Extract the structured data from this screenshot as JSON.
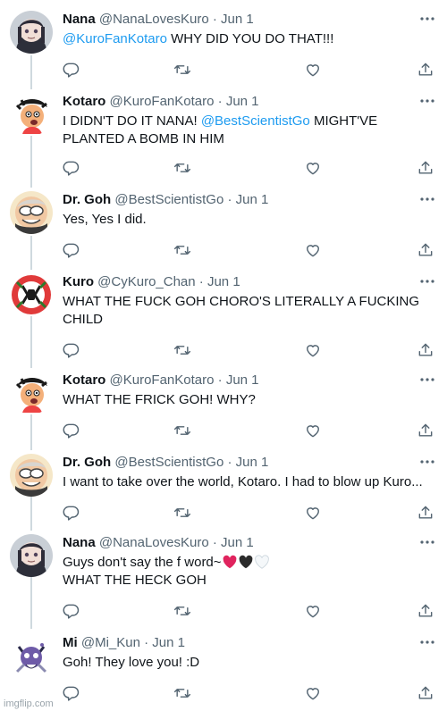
{
  "tweets": [
    {
      "name": "Nana",
      "handle": "@NanaLovesKuro",
      "time": "Jun 1",
      "mention": "@KuroFanKotaro",
      "text": " WHY DID YOU DO THAT!!!",
      "avatar": "nana-avatar"
    },
    {
      "name": "Kotaro",
      "handle": "@KuroFanKotaro",
      "time": "Jun 1",
      "text_a": "I DIDN'T DO IT NANA! ",
      "mention": "@BestScientistGo",
      "text_b": " MIGHT'VE PLANTED A BOMB IN HIM",
      "avatar": "kotaro-avatar"
    },
    {
      "name": "Dr. Goh",
      "handle": "@BestScientistGo",
      "time": "Jun 1",
      "text": "Yes, Yes I did.",
      "avatar": "goh-avatar"
    },
    {
      "name": "Kuro",
      "handle": "@CyKuro_Chan",
      "time": "Jun 1",
      "text": "WHAT THE FUCK GOH CHORO'S LITERALLY A FUCKING CHILD",
      "avatar": "kuro-avatar"
    },
    {
      "name": "Kotaro",
      "handle": "@KuroFanKotaro",
      "time": "Jun 1",
      "text": "WHAT THE FRICK GOH! WHY?",
      "avatar": "kotaro-avatar"
    },
    {
      "name": "Dr. Goh",
      "handle": "@BestScientistGo",
      "time": "Jun 1",
      "text": "I want to take over the world, Kotaro. I had to blow up Kuro...",
      "avatar": "goh-avatar"
    },
    {
      "name": "Nana",
      "handle": "@NanaLovesKuro",
      "time": "Jun 1",
      "text_a": "Guys don't say the f word~",
      "text_b": "WHAT THE HECK GOH",
      "hearts": [
        "red-heart",
        "black-heart",
        "white-heart"
      ],
      "avatar": "nana-avatar"
    },
    {
      "name": "Mi",
      "handle": "@Mi_Kun",
      "time": "Jun 1",
      "text": "Goh! They love you! :D",
      "avatar": "mi-avatar"
    }
  ],
  "separator": "·",
  "watermark": "imgflip.com",
  "colors": {
    "accent": "#1d9bf0",
    "muted": "#536471",
    "thread_line": "#cfd9de",
    "heart_red": "#e0245e",
    "heart_black": "#2b2b2b"
  }
}
